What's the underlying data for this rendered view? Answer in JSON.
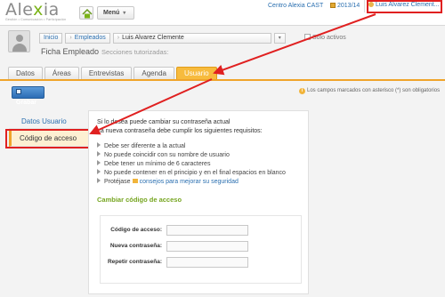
{
  "app": {
    "logo_text_a": "Ale",
    "logo_text_x": "x",
    "logo_text_b": "ia",
    "logo_tagline": "Gestión • Comunicación • Participación",
    "menu_label": "Menú",
    "menu_caret": "▾"
  },
  "header": {
    "center": "Centro Alexia CAST",
    "year": "2013/14",
    "user": "Luis Alvarez Clement..."
  },
  "breadcrumb": {
    "items": [
      "Inicio",
      "Empleados",
      "Luis Alvarez Clemente"
    ],
    "dropdown_symbol": "▾",
    "actives_label": "Sólo activos"
  },
  "page": {
    "title": "Ficha Empleado",
    "subtitle": "Secciones tutorizadas:"
  },
  "tabs": [
    {
      "label": "Datos"
    },
    {
      "label": "Áreas"
    },
    {
      "label": "Entrevistas"
    },
    {
      "label": "Agenda"
    },
    {
      "label": "Usuario"
    }
  ],
  "toolbar": {
    "save_label": "Grabar",
    "required_note": "Los campos marcados con asterisco (*) son obligatorios"
  },
  "sidebar": {
    "items": [
      {
        "label": "Datos Usuario"
      },
      {
        "label": "Código de acceso"
      }
    ]
  },
  "content": {
    "intro1": "Si lo desea puede cambiar su contraseña actual",
    "intro2": "La nueva contraseña debe cumplir los siguientes requisitos:",
    "requirements": [
      "Debe ser diferente a la actual",
      "No puede coincidir con su nombre de usuario",
      "Debe tener un mínimo de 6 caracteres",
      "No puede contener en el principio y en el final espacios en blanco"
    ],
    "tip_prefix": "Protéjase",
    "tip_link": "consejos para mejorar su seguridad",
    "section_title": "Cambiar código de acceso",
    "form": {
      "current_label": "Código de acceso:",
      "new_label": "Nueva contraseña:",
      "repeat_label": "Repetir contraseña:",
      "current_value": "",
      "new_value": "",
      "repeat_value": ""
    }
  },
  "colors": {
    "accent_orange": "#f0a42a",
    "highlight_red": "#e02020",
    "link_blue": "#2a6fb0",
    "section_green": "#76a520"
  },
  "icons": [
    "home-icon",
    "calendar-icon",
    "user-icon",
    "avatar-placeholder",
    "save-icon",
    "info-icon",
    "arrow-bullet-icon"
  ]
}
